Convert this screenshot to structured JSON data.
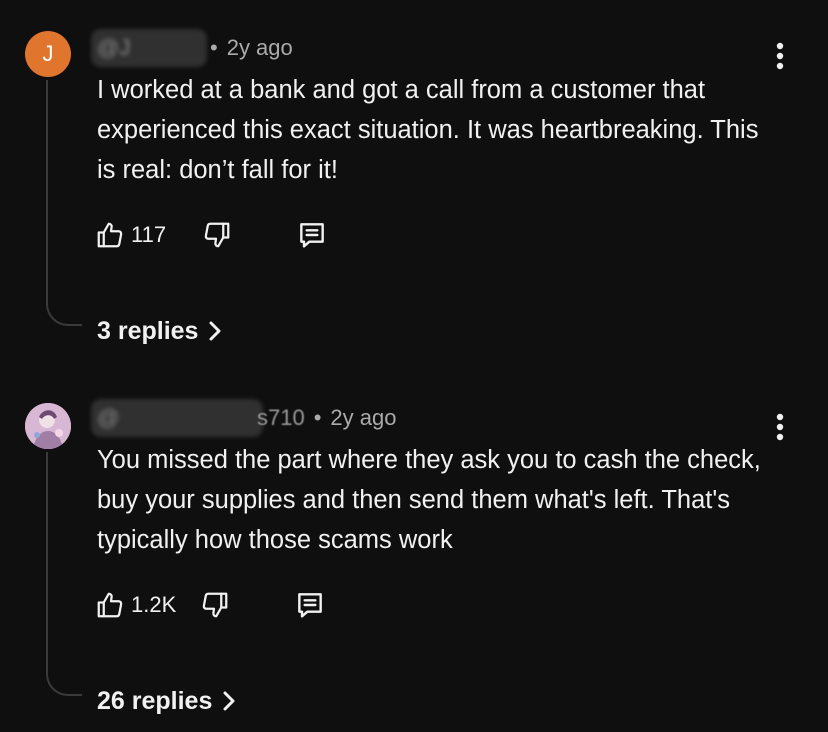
{
  "comments": [
    {
      "avatar_letter": "J",
      "avatar_color": "#e0752e",
      "handle": "@J",
      "time": "2y ago",
      "text": "I worked at a bank and got a call from a customer that experienced this exact situation. It was heartbreaking. This is real: don’t fall for it!",
      "likes": "117",
      "replies_label": "3 replies",
      "icons": [
        "thumbs-up-icon",
        "thumbs-down-icon",
        "reply-icon",
        "more-vert-icon",
        "chevron-right-icon"
      ]
    },
    {
      "avatar_letter": "",
      "avatar_color": "#c9a9c7",
      "handle": "@",
      "handle_suffix": "s710",
      "time": "2y ago",
      "text": "You missed the part where they ask you to cash the check, buy your supplies and then send them what's left. That's typically how those scams work",
      "likes": "1.2K",
      "replies_label": "26 replies",
      "icons": [
        "thumbs-up-icon",
        "thumbs-down-icon",
        "reply-icon",
        "more-vert-icon",
        "chevron-right-icon"
      ]
    }
  ],
  "separator": "•"
}
